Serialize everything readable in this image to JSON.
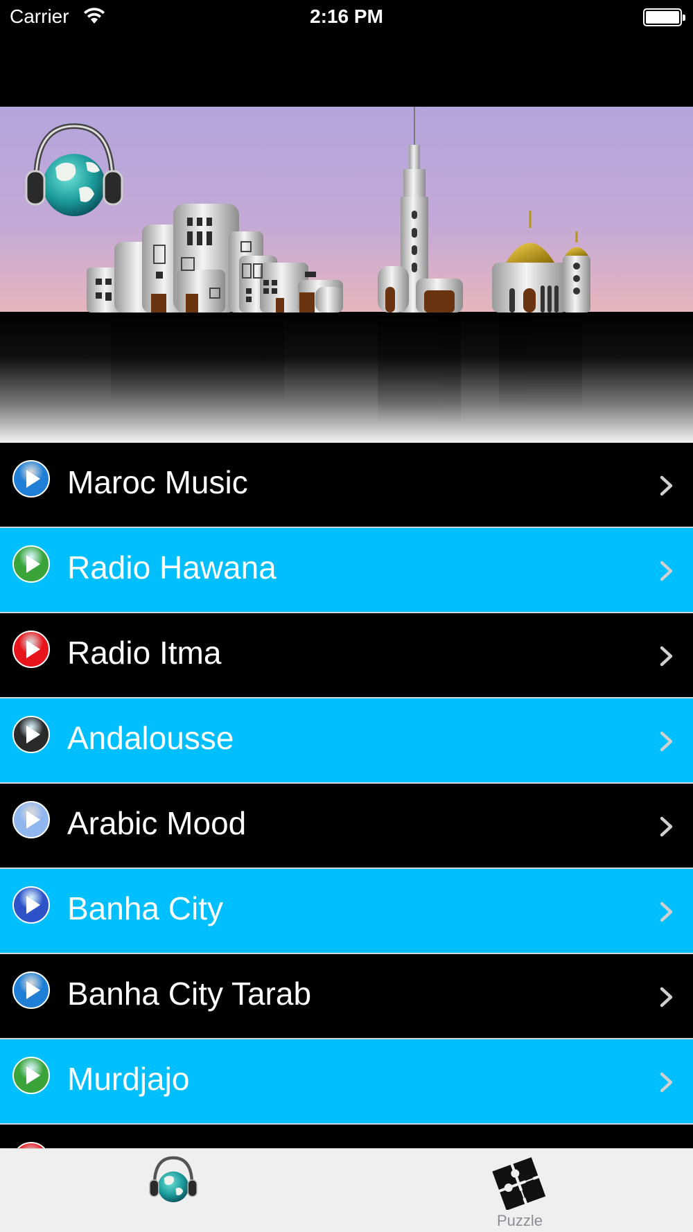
{
  "status_bar": {
    "carrier": "Carrier",
    "time": "2:16 PM"
  },
  "banner": {
    "logo_icon": "globe-headphones-icon",
    "scene": "city-skyline-illustration"
  },
  "stations": [
    {
      "label": "Maroc Music",
      "row_color": "#000000",
      "play_color": "#1f7fd6"
    },
    {
      "label": "Radio Hawana",
      "row_color": "#00bfff",
      "play_color": "#3aa43a"
    },
    {
      "label": "Radio Itma",
      "row_color": "#000000",
      "play_color": "#e8141b"
    },
    {
      "label": "Andalousse",
      "row_color": "#00bfff",
      "play_color": "#2a2a2a"
    },
    {
      "label": "Arabic Mood",
      "row_color": "#000000",
      "play_color": "#8fb6ee"
    },
    {
      "label": "Banha City",
      "row_color": "#00bfff",
      "play_color": "#2e52c8"
    },
    {
      "label": "Banha City Tarab",
      "row_color": "#000000",
      "play_color": "#1f7fd6"
    },
    {
      "label": "Murdjajo",
      "row_color": "#00bfff",
      "play_color": "#3aa43a"
    },
    {
      "label": "",
      "row_color": "#000000",
      "play_color": "#e8141b"
    }
  ],
  "tabbar": {
    "tabs": [
      {
        "label": "",
        "icon": "globe-headphones-icon",
        "selected": true
      },
      {
        "label": "Puzzle",
        "icon": "puzzle-icon",
        "selected": false
      }
    ]
  }
}
